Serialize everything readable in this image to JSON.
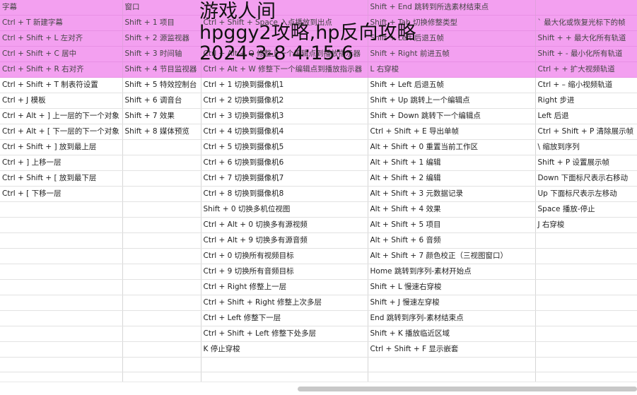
{
  "watermark": {
    "line1": "游戏人间",
    "line2": "hpggy2攻略,hp反向攻略",
    "line3": "2024-3-8 4:15:6"
  },
  "header_rows": [
    [
      "字幕",
      "窗口",
      "",
      "Shift + End 跳转到所选素材结束点",
      ""
    ],
    [
      "Ctrl + T 新建字幕",
      "Shift + 1 项目",
      "Ctrl + Shift + Space 入点播放到出点",
      "Shift + Tab 切换修整类型",
      "` 最大化或恢复光标下的帧"
    ],
    [
      "Ctrl + Shift + L 左对齐",
      "Shift + 2 源监视器",
      "",
      "Shift + Left 后退五帧",
      "Shift + + 最大化所有轨道"
    ],
    [
      "Ctrl + Shift + C 居中",
      "Shift + 3 时间轴",
      "Ctrl + Alt + Q 修整上一个编辑点到播放指示器",
      "Shift + Right 前进五帧",
      "Shift + - 最小化所有轨道"
    ],
    [
      "Ctrl + Shift + R 右对齐",
      "Shift + 4 节目监视器",
      "Ctrl + Alt + W 修整下一个编辑点到播放指示器",
      "L 右穿梭",
      "Ctrl + + 扩大视频轨道"
    ]
  ],
  "rows": [
    [
      "Ctrl + Shift + T 制表符设置",
      "Shift + 5 特效控制台",
      "Ctrl + 1 切换到摄像机1",
      "Shift + Left 后退五帧",
      "Ctrl + – 缩小视频轨道"
    ],
    [
      "Ctrl + J 模板",
      "Shift + 6 调音台",
      "Ctrl + 2 切换到摄像机2",
      "Shift + Up 跳转上一个编辑点",
      "Right 步进"
    ],
    [
      "Ctrl + Alt + ] 上一层的下一个对象",
      "Shift + 7 效果",
      "Ctrl + 3 切换到摄像机3",
      "Shift + Down 跳转下一个编辑点",
      "Left 后退"
    ],
    [
      "Ctrl + Alt + [ 下一层的下一个对象",
      "Shift + 8 媒体预览",
      "Ctrl + 4 切换到摄像机4",
      "Ctrl + Shift + E 导出单帧",
      "Ctrl + Shift + P 清除展示帧"
    ],
    [
      "Ctrl + Shift + ] 放到最上层",
      "",
      "Ctrl + 5 切换到摄像机5",
      "Alt + Shift + 0 重置当前工作区",
      "\\ 缩放到序列"
    ],
    [
      "Ctrl + ] 上移一层",
      "",
      "Ctrl + 6 切换到摄像机6",
      "Alt + Shift + 1 编辑",
      "Shift + P 设置展示帧"
    ],
    [
      "Ctrl + Shift + [ 放到最下层",
      "",
      "Ctrl + 7 切换到摄像机7",
      "Alt + Shift + 2 编辑",
      "Down 下面标尺表示右移动"
    ],
    [
      "Ctrl + [ 下移一层",
      "",
      "Ctrl + 8 切换到摄像机8",
      "Alt + Shift + 3 元数据记录",
      "Up 下面标尺表示左移动"
    ],
    [
      "",
      "",
      "Shift + 0 切换多机位视图",
      "Alt + Shift + 4 效果",
      "Space 播放-停止"
    ],
    [
      "",
      "",
      "Ctrl + Alt + 0 切换多有源视频",
      "Alt + Shift + 5 项目",
      "J 右穿梭"
    ],
    [
      "",
      "",
      "Ctrl + Alt + 9 切换多有源音频",
      "Alt + Shift + 6 音频",
      ""
    ],
    [
      "",
      "",
      "Ctrl + 0 切换所有视频目标",
      "Alt + Shift + 7 颜色校正（三视图窗口）",
      ""
    ],
    [
      "",
      "",
      "Ctrl + 9 切换所有音频目标",
      "Home 跳转到序列-素材开始点",
      ""
    ],
    [
      "",
      "",
      "Ctrl + Right 修整上一层",
      "Shift + L 慢速右穿梭",
      ""
    ],
    [
      "",
      "",
      "Ctrl + Shift + Right 修整上次多层",
      "Shift + J 慢速左穿梭",
      ""
    ],
    [
      "",
      "",
      "Ctrl + Left 修整下一层",
      "End 跳转到序列-素材结束点",
      ""
    ],
    [
      "",
      "",
      "Ctrl + Shift + Left 修整下处多层",
      "Shift + K 播放临近区域",
      ""
    ],
    [
      "",
      "",
      "K 停止穿梭",
      "Ctrl + Shift + F 显示嵌套",
      ""
    ],
    [
      "",
      "",
      "",
      "",
      ""
    ],
    [
      "",
      "",
      "",
      "",
      ""
    ]
  ]
}
